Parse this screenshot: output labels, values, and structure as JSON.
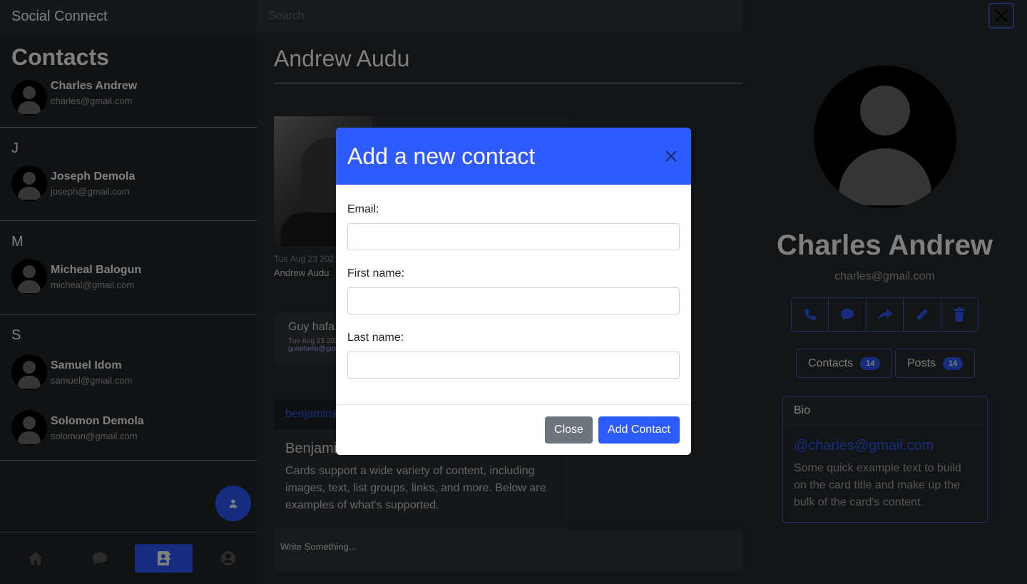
{
  "app": {
    "brand": "Social Connect"
  },
  "sidebar": {
    "title": "Contacts",
    "groups": [
      {
        "letter": "",
        "contacts": [
          {
            "name": "Charles Andrew",
            "email": "charles@gmail.com"
          }
        ]
      },
      {
        "letter": "J",
        "contacts": [
          {
            "name": "Joseph Demola",
            "email": "joseph@gmail.com"
          }
        ]
      },
      {
        "letter": "M",
        "contacts": [
          {
            "name": "Micheal Balogun",
            "email": "micheal@gmail.com"
          }
        ]
      },
      {
        "letter": "S",
        "contacts": [
          {
            "name": "Samuel Idom",
            "email": "samuel@gmail.com"
          },
          {
            "name": "Solomon Demola",
            "email": "solomon@gmail.com"
          }
        ]
      }
    ],
    "nav": [
      "home-icon",
      "chat-icon",
      "contacts-icon",
      "profile-icon"
    ],
    "active_nav": "contacts-icon"
  },
  "search": {
    "placeholder": "Search"
  },
  "chat": {
    "title": "Andrew Audu",
    "post_date": "Tue Aug 23 202",
    "post_author": "Andrew Audu",
    "bubble_text": "Guy hafa",
    "bubble_date": "Tue Aug 23 202",
    "bubble_email": "gokebello@gma",
    "card_header": "benjamin@",
    "card_title": "Benjami",
    "card_text": "Cards support a wide variety of content, including images, text, list groups, links, and more. Below are examples of what's supported.",
    "compose_placeholder": "Write Something..."
  },
  "profile": {
    "name": "Charles Andrew",
    "email": "charles@gmail.com",
    "actions": [
      "phone-icon",
      "message-icon",
      "share-icon",
      "edit-icon",
      "trash-icon"
    ],
    "contacts_label": "Contacts",
    "contacts_count": "14",
    "posts_label": "Posts",
    "posts_count": "14",
    "bio_title": "Bio",
    "bio_handle": "@charles@gmail.com",
    "bio_text": "Some quick example text to build on the card title and make up the bulk of the card's content."
  },
  "modal": {
    "title": "Add a new contact",
    "email_label": "Email:",
    "email_value": "",
    "first_name_label": "First name:",
    "first_name_value": "",
    "last_name_label": "Last name:",
    "last_name_value": "",
    "close_label": "Close",
    "submit_label": "Add Contact"
  },
  "colors": {
    "accent": "#2d5bff",
    "secondary": "#6c757d"
  }
}
